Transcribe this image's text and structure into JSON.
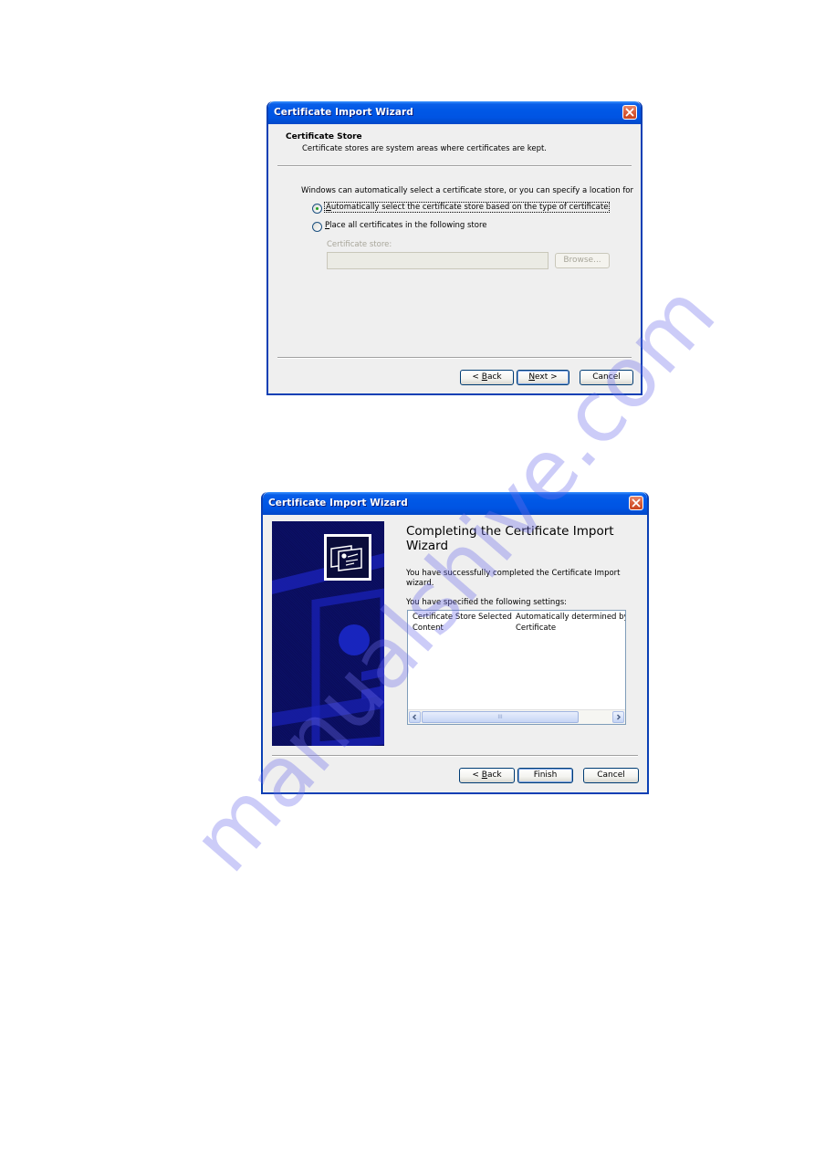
{
  "watermark": "manualshive.com",
  "colors": {
    "titlebar": "#0054e3",
    "close_button": "#d85e3b",
    "dialog_bg": "#efefef",
    "side_panel": "#0b0f66",
    "watermark": "#6e6eeb"
  },
  "dialog1": {
    "title": "Certificate Import Wizard",
    "close_icon": "close-icon",
    "header_title": "Certificate Store",
    "header_subtitle": "Certificate stores are system areas where certificates are kept.",
    "intro": "Windows can automatically select a certificate store, or you can specify a location for",
    "options": [
      {
        "label_ul": "A",
        "label_rest": "utomatically select the certificate store based on the type of certificate",
        "selected": true
      },
      {
        "label_ul": "P",
        "label_rest": "lace all certificates in the following store",
        "selected": false
      }
    ],
    "store_label": "Certificate store:",
    "store_value": "",
    "browse_label": "Browse...",
    "buttons": {
      "back_pre": "< ",
      "back_ul": "B",
      "back_rest": "ack",
      "next_ul": "N",
      "next_rest": "ext >",
      "cancel": "Cancel"
    }
  },
  "dialog2": {
    "title": "Certificate Import Wizard",
    "close_icon": "close-icon",
    "side_icon": "certificate-icon",
    "heading": "Completing the Certificate Import Wizard",
    "success_text": "You have successfully completed the Certificate Import wizard.",
    "settings_label": "You have specified the following settings:",
    "settings": [
      {
        "name": "Certificate Store Selected",
        "value": "Automatically determined by t"
      },
      {
        "name": "Content",
        "value": "Certificate"
      }
    ],
    "scrollbar_thumb": "III",
    "buttons": {
      "back_pre": "< ",
      "back_ul": "B",
      "back_rest": "ack",
      "finish": "Finish",
      "cancel": "Cancel"
    }
  }
}
